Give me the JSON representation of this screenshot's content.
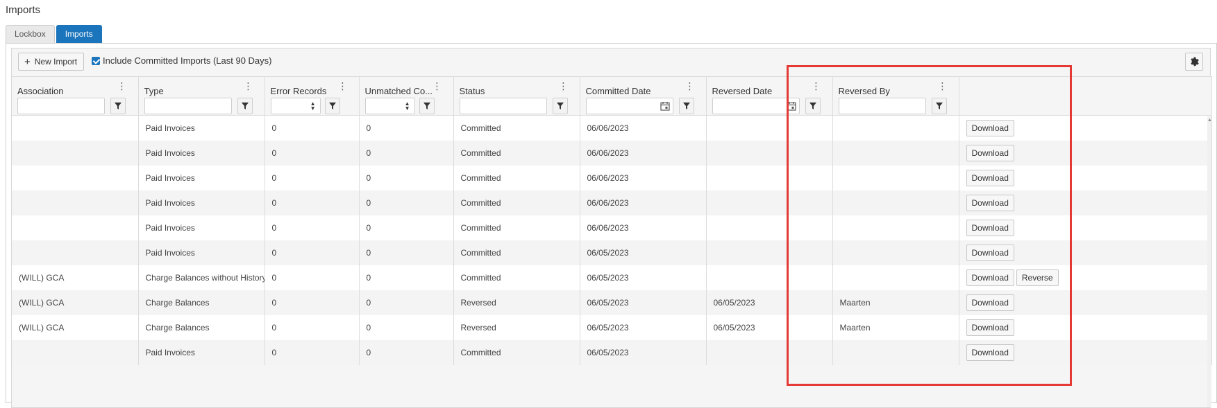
{
  "page": {
    "title": "Imports"
  },
  "tabs": [
    {
      "label": "Lockbox",
      "active": false
    },
    {
      "label": "Imports",
      "active": true
    }
  ],
  "toolbar": {
    "new_import_label": "New Import",
    "include_committed_label": "Include Committed Imports (Last 90 Days)",
    "include_committed_checked": true
  },
  "grid": {
    "columns": [
      {
        "label": "Association"
      },
      {
        "label": "Type"
      },
      {
        "label": "Error Records"
      },
      {
        "label": "Unmatched Co..."
      },
      {
        "label": "Status"
      },
      {
        "label": "Committed Date"
      },
      {
        "label": "Reversed Date"
      },
      {
        "label": "Reversed By"
      }
    ],
    "rows": [
      {
        "association": "",
        "type": "Paid Invoices",
        "error_records": "0",
        "unmatched": "0",
        "status": "Committed",
        "committed_date": "06/06/2023",
        "reversed_date": "",
        "reversed_by": "",
        "actions": [
          "Download"
        ]
      },
      {
        "association": "",
        "type": "Paid Invoices",
        "error_records": "0",
        "unmatched": "0",
        "status": "Committed",
        "committed_date": "06/06/2023",
        "reversed_date": "",
        "reversed_by": "",
        "actions": [
          "Download"
        ]
      },
      {
        "association": "",
        "type": "Paid Invoices",
        "error_records": "0",
        "unmatched": "0",
        "status": "Committed",
        "committed_date": "06/06/2023",
        "reversed_date": "",
        "reversed_by": "",
        "actions": [
          "Download"
        ]
      },
      {
        "association": "",
        "type": "Paid Invoices",
        "error_records": "0",
        "unmatched": "0",
        "status": "Committed",
        "committed_date": "06/06/2023",
        "reversed_date": "",
        "reversed_by": "",
        "actions": [
          "Download"
        ]
      },
      {
        "association": "",
        "type": "Paid Invoices",
        "error_records": "0",
        "unmatched": "0",
        "status": "Committed",
        "committed_date": "06/06/2023",
        "reversed_date": "",
        "reversed_by": "",
        "actions": [
          "Download"
        ]
      },
      {
        "association": "",
        "type": "Paid Invoices",
        "error_records": "0",
        "unmatched": "0",
        "status": "Committed",
        "committed_date": "06/05/2023",
        "reversed_date": "",
        "reversed_by": "",
        "actions": [
          "Download"
        ]
      },
      {
        "association": "(WILL) GCA",
        "type": "Charge Balances without History",
        "error_records": "0",
        "unmatched": "0",
        "status": "Committed",
        "committed_date": "06/05/2023",
        "reversed_date": "",
        "reversed_by": "",
        "actions": [
          "Download",
          "Reverse"
        ]
      },
      {
        "association": "(WILL) GCA",
        "type": "Charge Balances",
        "error_records": "0",
        "unmatched": "0",
        "status": "Reversed",
        "committed_date": "06/05/2023",
        "reversed_date": "06/05/2023",
        "reversed_by": "Maarten",
        "actions": [
          "Download"
        ]
      },
      {
        "association": "(WILL) GCA",
        "type": "Charge Balances",
        "error_records": "0",
        "unmatched": "0",
        "status": "Reversed",
        "committed_date": "06/05/2023",
        "reversed_date": "06/05/2023",
        "reversed_by": "Maarten",
        "actions": [
          "Download"
        ]
      },
      {
        "association": "",
        "type": "Paid Invoices",
        "error_records": "0",
        "unmatched": "0",
        "status": "Committed",
        "committed_date": "06/05/2023",
        "reversed_date": "",
        "reversed_by": "",
        "actions": [
          "Download"
        ]
      }
    ]
  },
  "icons": {
    "filter": "filter-icon",
    "kebab": "kebab-menu-icon",
    "calendar": "calendar-icon",
    "gear": "gear-icon",
    "plus": "plus-icon"
  },
  "colors": {
    "accent": "#1b75bc",
    "highlight": "#e53935"
  }
}
